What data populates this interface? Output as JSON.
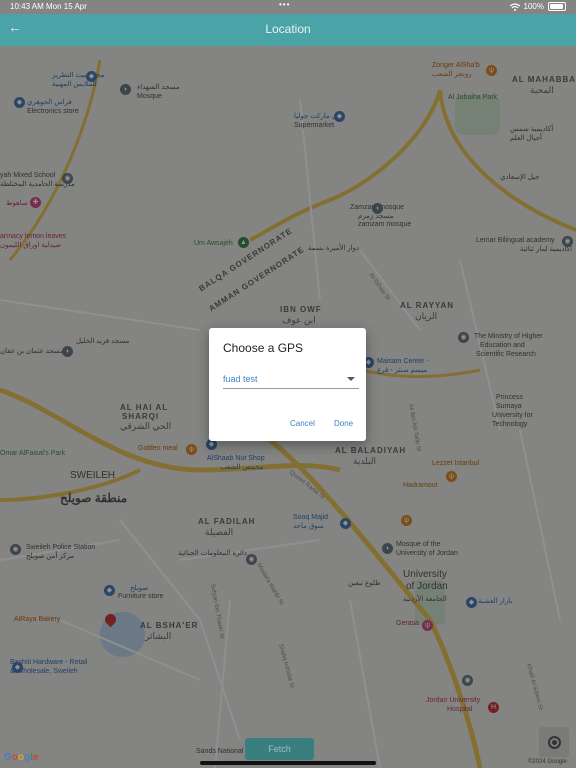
{
  "status_bar": {
    "time": "10:43 AM",
    "date": "Mon 15 Apr",
    "dots": "•••",
    "battery": "100%"
  },
  "app_bar": {
    "back_icon": "arrow-back-icon",
    "title": "Location"
  },
  "map": {
    "labels": [
      {
        "text": "مجمع بيت التطريز",
        "cls": "blue"
      },
      {
        "text": "للملابس المهنية",
        "cls": "blue"
      },
      {
        "text": "فراس الجوهري",
        "cls": "blue"
      },
      {
        "text": "Electronics store",
        "cls": ""
      },
      {
        "text": "مسجد الشهداء",
        "cls": ""
      },
      {
        "text": "Mosque",
        "cls": ""
      },
      {
        "text": "Zonger AlSha'b",
        "cls": "orange"
      },
      {
        "text": "زونجر الشعب",
        "cls": "orange"
      },
      {
        "text": "AL MAHABBAH",
        "cls": "district"
      },
      {
        "text": "المحبة",
        "cls": "district-ar"
      },
      {
        "text": "Al Jubaiha Park",
        "cls": "green"
      },
      {
        "text": "مي ماركت جوليا",
        "cls": "blue"
      },
      {
        "text": "Supermarket",
        "cls": ""
      },
      {
        "text": "أكاديمية شمس",
        "cls": ""
      },
      {
        "text": "أجيال العلم",
        "cls": ""
      },
      {
        "text": "yah Mixed School",
        "cls": ""
      },
      {
        "text": "مدرسة الحامدية المختلطة",
        "cls": ""
      },
      {
        "text": "جيل الإسعادي",
        "cls": ""
      },
      {
        "text": "ساهوط",
        "cls": "red"
      },
      {
        "text": "armacy lemon leaves",
        "cls": "red"
      },
      {
        "text": "صيدلية اوراق الليمون",
        "cls": "red"
      },
      {
        "text": "Zamzam mosque",
        "cls": ""
      },
      {
        "text": "مسجد زمزم",
        "cls": ""
      },
      {
        "text": "zamzam mosque",
        "cls": ""
      },
      {
        "text": "Lemar Bilingual academy",
        "cls": ""
      },
      {
        "text": "أكاديمية لمار ثنائية",
        "cls": ""
      },
      {
        "text": "Um Awsajeh",
        "cls": "green"
      },
      {
        "text": "دوار الأميرة بسمة",
        "cls": ""
      },
      {
        "text": "BALQA GOVERNORATE",
        "cls": "district"
      },
      {
        "text": "AMMAN GOVERNORATE",
        "cls": "district"
      },
      {
        "text": "IBN OWF",
        "cls": "district"
      },
      {
        "text": "ابن عوف",
        "cls": "district-ar"
      },
      {
        "text": "AL RAYYAN",
        "cls": "district"
      },
      {
        "text": "الريان",
        "cls": "district-ar"
      },
      {
        "text": "The Ministry of Higher",
        "cls": ""
      },
      {
        "text": "Education and",
        "cls": ""
      },
      {
        "text": "Scientific Research",
        "cls": ""
      },
      {
        "text": "مسجد عثمان بن عفان",
        "cls": ""
      },
      {
        "text": "مسجد فريد الخليل",
        "cls": ""
      },
      {
        "text": "Maisam Center -",
        "cls": "blue"
      },
      {
        "text": "ميسم سنتر - فرع",
        "cls": "blue"
      },
      {
        "text": "Princess",
        "cls": ""
      },
      {
        "text": "Sumaya",
        "cls": ""
      },
      {
        "text": "University for",
        "cls": ""
      },
      {
        "text": "Technology",
        "cls": ""
      },
      {
        "text": "AL HAI AL",
        "cls": "district"
      },
      {
        "text": "SHARQI",
        "cls": "district"
      },
      {
        "text": "الحي الشرقي",
        "cls": "district-ar"
      },
      {
        "text": "AL BALADIYAH",
        "cls": "district"
      },
      {
        "text": "البلدية",
        "cls": "district-ar"
      },
      {
        "text": "Omar AlFaisal's Park",
        "cls": "green"
      },
      {
        "text": "Golden meal",
        "cls": "orange"
      },
      {
        "text": "AlShaab Nut Shop",
        "cls": "blue"
      },
      {
        "text": "محمص الشعب",
        "cls": "blue"
      },
      {
        "text": "Lezzet Istanbul",
        "cls": "orange"
      },
      {
        "text": "SWEILEH",
        "cls": "big"
      },
      {
        "text": "منطقة صويلح",
        "cls": "big-ar"
      },
      {
        "text": "Hadramout",
        "cls": "orange"
      },
      {
        "text": "AL FADILAH",
        "cls": "district"
      },
      {
        "text": "الفضيلة",
        "cls": "district-ar"
      },
      {
        "text": "Sooq Majid",
        "cls": "blue"
      },
      {
        "text": "سوق ماجد",
        "cls": "blue"
      },
      {
        "text": "Sweileh Police Station",
        "cls": ""
      },
      {
        "text": "مركز أمن صويلح",
        "cls": ""
      },
      {
        "text": "دائرة المعلومات الجنائية",
        "cls": ""
      },
      {
        "text": "Mosque of the",
        "cls": ""
      },
      {
        "text": "University of Jordan",
        "cls": ""
      },
      {
        "text": "University",
        "cls": "big"
      },
      {
        "text": "of Jordan",
        "cls": "big"
      },
      {
        "text": "الجامعة الأردنية",
        "cls": ""
      },
      {
        "text": "طلوع نيفين",
        "cls": ""
      },
      {
        "text": "بازار العشبة",
        "cls": "blue"
      },
      {
        "text": "صويلح",
        "cls": "blue"
      },
      {
        "text": "Furniture store",
        "cls": ""
      },
      {
        "text": "AlRaya Bakery",
        "cls": "orange"
      },
      {
        "text": "AL BSHA'ER",
        "cls": "district"
      },
      {
        "text": "البشائر",
        "cls": "district-ar"
      },
      {
        "text": "Gerasa",
        "cls": "red"
      },
      {
        "text": "Bashiti Hardware - Retail",
        "cls": "blue"
      },
      {
        "text": "& Wholesale, Sweileh",
        "cls": "blue"
      },
      {
        "text": "Jordan University",
        "cls": "red"
      },
      {
        "text": "Hospital",
        "cls": "red"
      },
      {
        "text": "Sands National Academy",
        "cls": ""
      },
      {
        "text": "Queen Rania St",
        "cls": "street"
      },
      {
        "text": "Al-Ilshaw St",
        "cls": "street"
      },
      {
        "text": "Ali Bin Abi Talib St",
        "cls": "street"
      },
      {
        "text": "Mustafa Wahbi St",
        "cls": "street"
      },
      {
        "text": "Sufyan Ibn Thawri St",
        "cls": "street"
      },
      {
        "text": "Shafiq Irshidat St",
        "cls": "street"
      },
      {
        "text": "Khalil Al-Salem St",
        "cls": "street"
      }
    ]
  },
  "dialog": {
    "title": "Choose a GPS",
    "selected_value": "fuad test",
    "cancel_label": "Cancel",
    "done_label": "Done"
  },
  "bottom": {
    "fetch_label": "Fetch",
    "locate_icon": "my-location-icon",
    "google_logo": "Google",
    "copyright": "©2024 Google"
  }
}
